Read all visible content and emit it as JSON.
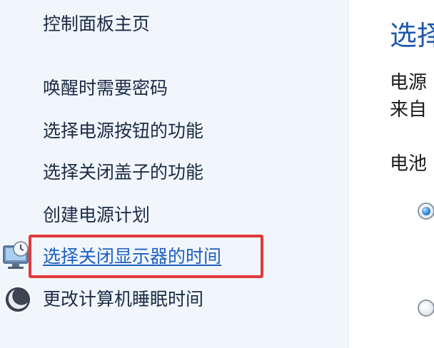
{
  "sidebar": {
    "home": "控制面板主页",
    "items": [
      {
        "label": "唤醒时需要密码",
        "icon": ""
      },
      {
        "label": "选择电源按钮的功能",
        "icon": ""
      },
      {
        "label": "选择关闭盖子的功能",
        "icon": ""
      },
      {
        "label": "创建电源计划",
        "icon": ""
      },
      {
        "label": "选择关闭显示器的时间",
        "icon": "display-clock-icon",
        "highlighted": true
      },
      {
        "label": "更改计算机睡眠时间",
        "icon": "moon-icon"
      }
    ]
  },
  "main": {
    "title": "选择",
    "description_line1": "电源",
    "description_line2": "来自",
    "section_label": "电池",
    "radio_options": [
      {
        "selected": true
      },
      {
        "selected": false
      }
    ]
  },
  "colors": {
    "sidebar_bg": "#f1f6fc",
    "link_active": "#1e5fc0",
    "highlight_border": "#e0393b",
    "title_blue": "#1c58a8"
  }
}
